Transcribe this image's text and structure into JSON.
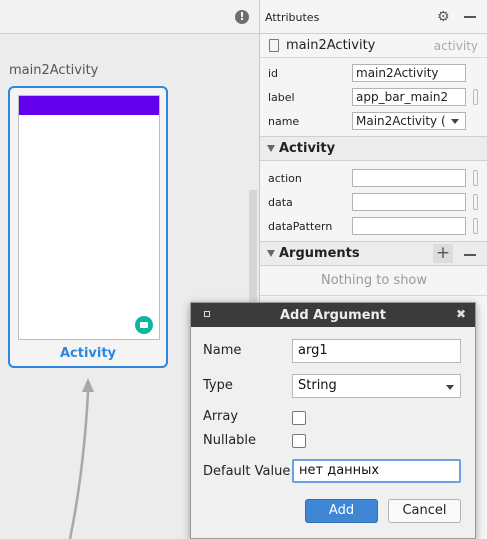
{
  "canvas": {
    "destination": {
      "label": "main2Activity",
      "type_label": "Activity"
    }
  },
  "attributes": {
    "title": "Attributes",
    "component": {
      "name": "main2Activity",
      "type": "activity"
    },
    "properties": [
      {
        "label": "id",
        "value": "main2Activity"
      },
      {
        "label": "label",
        "value": "app_bar_main2"
      },
      {
        "label": "name",
        "value": "Main2Activity ("
      }
    ],
    "activity_section": {
      "title": "Activity",
      "fields": [
        {
          "label": "action",
          "value": ""
        },
        {
          "label": "data",
          "value": ""
        },
        {
          "label": "dataPattern",
          "value": ""
        }
      ]
    },
    "arguments_section": {
      "title": "Arguments",
      "empty_text": "Nothing to show"
    }
  },
  "dialog": {
    "title": "Add Argument",
    "name_label": "Name",
    "name_value": "arg1",
    "type_label": "Type",
    "type_value": "String",
    "array_label": "Array",
    "array_checked": false,
    "nullable_label": "Nullable",
    "nullable_checked": false,
    "default_label": "Default Value",
    "default_value": "нет данных",
    "add_label": "Add",
    "cancel_label": "Cancel"
  },
  "icons": {
    "warning": "warning-icon",
    "gear": "gear-icon",
    "minimize": "minimize-icon",
    "component": "activity-icon",
    "add": "add-icon",
    "close": "close-icon"
  },
  "colors": {
    "selection": "#2d87e0",
    "app_bar": "#6200ee",
    "fab": "#0fb5a3",
    "primary_button": "#3f86d4",
    "dialog_titlebar": "#3b3b3b"
  }
}
